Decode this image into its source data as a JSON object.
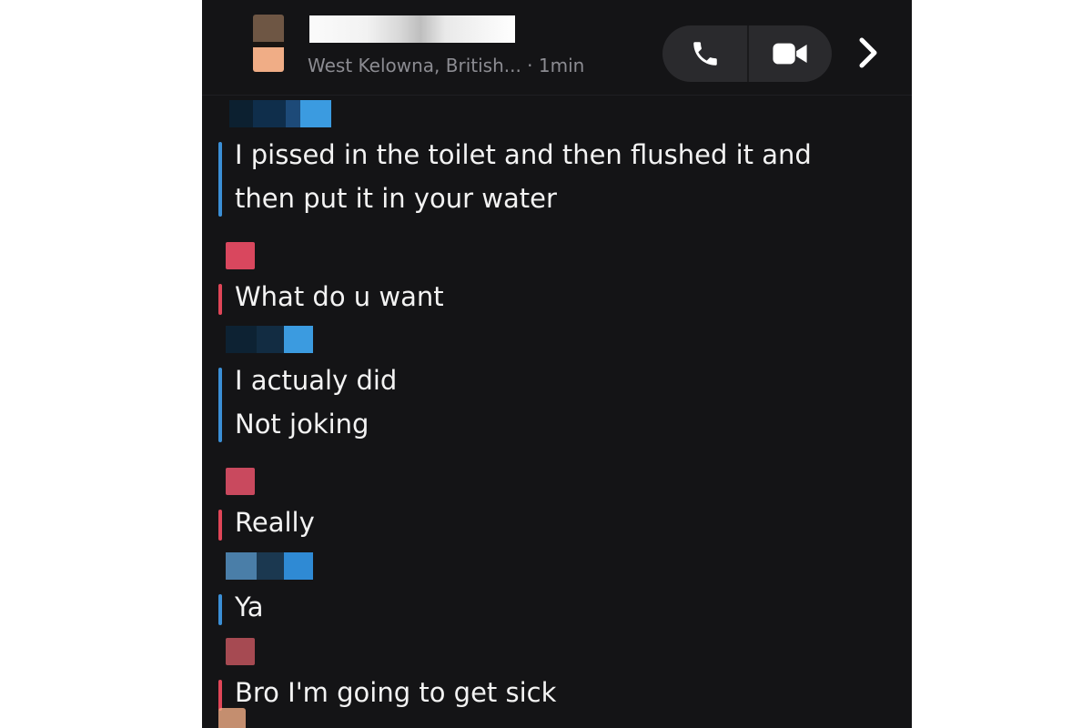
{
  "header": {
    "subtitle": "West Kelowna, British... · 1min",
    "call_icon": "phone-icon",
    "video_icon": "video-camera-icon",
    "next_icon": "chevron-right-icon"
  },
  "colors": {
    "background": "#141416",
    "mine_accent": "#e04658",
    "theirs_accent": "#3b8fd6",
    "text": "#f3f3f3"
  },
  "messages": [
    {
      "from": "theirs",
      "lines": [
        "I pissed in the toilet and then flushed it and",
        "then put it in your water"
      ]
    },
    {
      "from": "mine",
      "lines": [
        "What do u want"
      ]
    },
    {
      "from": "theirs",
      "lines": [
        "I actualy did",
        "Not joking"
      ]
    },
    {
      "from": "mine",
      "lines": [
        "Really"
      ]
    },
    {
      "from": "theirs",
      "lines": [
        "Ya"
      ]
    },
    {
      "from": "mine",
      "lines": [
        "Bro I'm going to get sick"
      ]
    }
  ]
}
